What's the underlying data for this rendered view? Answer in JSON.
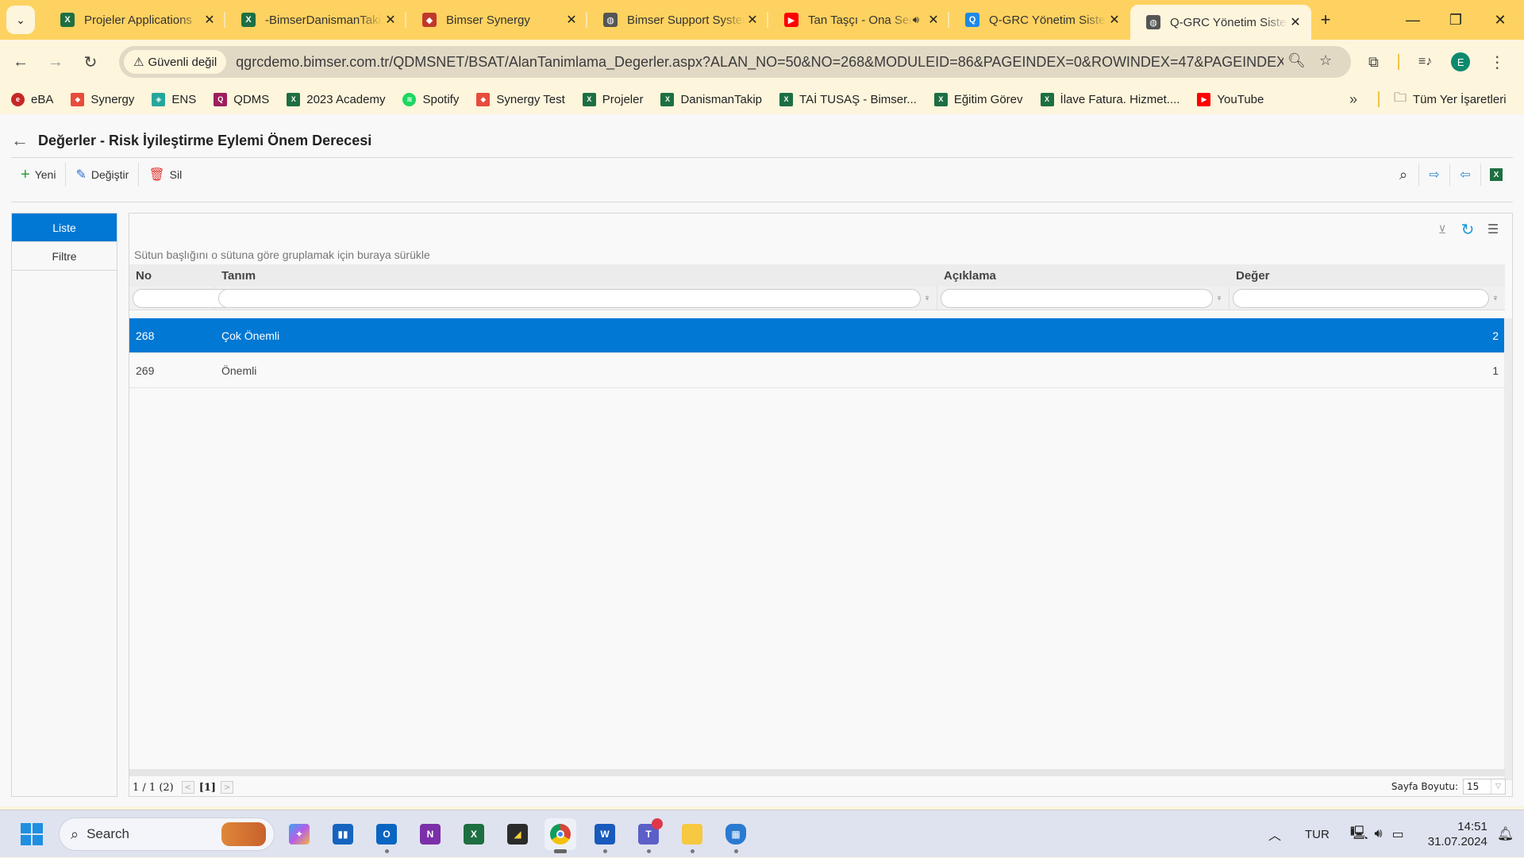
{
  "browser": {
    "tabs": [
      {
        "title": "Projeler Applications",
        "icon": "excel-icon",
        "color": "#1d6f42"
      },
      {
        "title": "-BimserDanismanTakip",
        "icon": "excel-icon",
        "color": "#1d6f42"
      },
      {
        "title": "Bimser Synergy",
        "icon": "synergy-icon",
        "color": "#c0392b"
      },
      {
        "title": "Bimser Support System",
        "icon": "globe-icon",
        "color": "#555555"
      },
      {
        "title": "Tan Taşçı - Ona Sen",
        "icon": "youtube-icon",
        "color": "#ff0000"
      },
      {
        "title": "Q-GRC Yönetim Sistemi",
        "icon": "qgrc-icon",
        "color": "#1e88e5"
      },
      {
        "title": "Q-GRC Yönetim Sistemi",
        "icon": "globe-icon",
        "color": "#555555"
      }
    ],
    "active_tab_index": 6,
    "security_label": "Güvenli değil",
    "url": "qgrcdemo.bimser.com.tr/QDMSNET/BSAT/AlanTanimlama_Degerler.aspx?ALAN_NO=50&NO=268&MODULEID=86&PAGEINDEX=0&ROWINDEX=47&PAGEINDEX2=0&...",
    "profile_initial": "E",
    "bookmarks": [
      {
        "label": "eBA",
        "icon": "eba-icon",
        "color": "#c62828"
      },
      {
        "label": "Synergy",
        "icon": "synergy-icon",
        "color": "#e74c3c"
      },
      {
        "label": "ENS",
        "icon": "ens-icon",
        "color": "#26a69a"
      },
      {
        "label": "QDMS",
        "icon": "qdms-icon",
        "color": "#9c1f5c"
      },
      {
        "label": "2023 Academy",
        "icon": "excel-icon",
        "color": "#1d6f42"
      },
      {
        "label": "Spotify",
        "icon": "spotify-icon",
        "color": "#1ed760"
      },
      {
        "label": "Synergy Test",
        "icon": "synergy-icon",
        "color": "#e74c3c"
      },
      {
        "label": "Projeler",
        "icon": "excel-icon",
        "color": "#1d6f42"
      },
      {
        "label": "DanismanTakip",
        "icon": "excel-icon",
        "color": "#1d6f42"
      },
      {
        "label": "TAİ TUSAŞ - Bimser...",
        "icon": "excel-icon",
        "color": "#1d6f42"
      },
      {
        "label": "Eğitim Görev",
        "icon": "excel-icon",
        "color": "#1d6f42"
      },
      {
        "label": "İlave Fatura. Hizmet....",
        "icon": "excel-icon",
        "color": "#1d6f42"
      },
      {
        "label": "YouTube",
        "icon": "youtube-icon",
        "color": "#ff0000"
      }
    ],
    "all_bookmarks_label": "Tüm Yer İşaretleri"
  },
  "page": {
    "title": "Değerler - Risk İyileştirme Eylemi Önem Derecesi",
    "toolbar": {
      "new": "Yeni",
      "edit": "Değiştir",
      "delete": "Sil"
    },
    "sidenav": [
      {
        "label": "Liste",
        "active": true
      },
      {
        "label": "Filtre",
        "active": false
      }
    ],
    "grid": {
      "group_hint": "Sütun başlığını o sütuna göre gruplamak için buraya sürükle",
      "columns": [
        "No",
        "Tanım",
        "Açıklama",
        "Değer"
      ],
      "rows": [
        {
          "no": "268",
          "tanim": "Çok Önemli",
          "aciklama": "",
          "deger": "2",
          "selected": true
        },
        {
          "no": "269",
          "tanim": "Önemli",
          "aciklama": "",
          "deger": "1",
          "selected": false
        }
      ],
      "pager": {
        "summary": "1 / 1 (2)",
        "current": "[1]",
        "page_size_label": "Sayfa Boyutu:",
        "page_size": "15"
      }
    },
    "accent_color": "#0078d4"
  },
  "taskbar": {
    "search_placeholder": "Search",
    "language": "TUR",
    "time": "14:51",
    "date": "31.07.2024"
  }
}
